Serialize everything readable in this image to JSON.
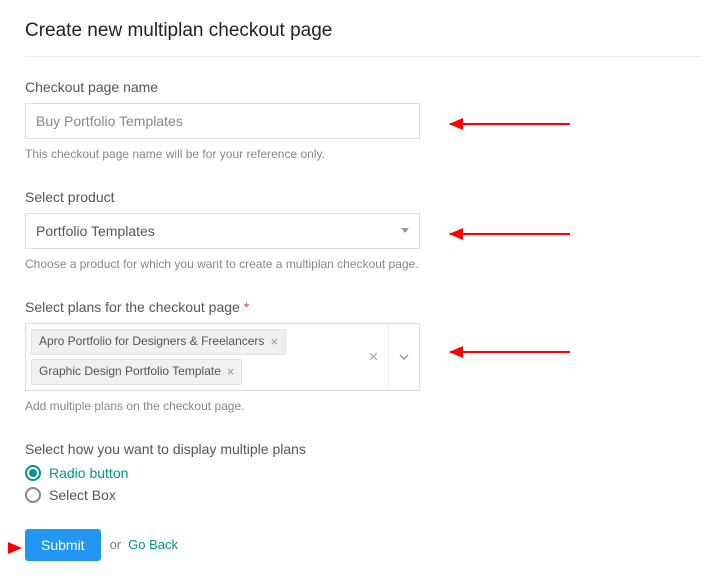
{
  "page_title": "Create new multiplan checkout page",
  "checkout_name": {
    "label": "Checkout page name",
    "value": "Buy Portfolio Templates",
    "help": "This checkout page name will be for your reference only."
  },
  "product": {
    "label": "Select product",
    "value": "Portfolio Templates",
    "help": "Choose a product for which you want to create a multiplan checkout page."
  },
  "plans": {
    "label": "Select plans for the checkout page",
    "required": "*",
    "chips": [
      "Apro Portfolio for Designers & Freelancers",
      "Graphic Design Portfolio Template"
    ],
    "help": "Add multiple plans on the checkout page."
  },
  "display": {
    "label": "Select how you want to display multiple plans",
    "options": [
      "Radio button",
      "Select Box"
    ],
    "selected": 0
  },
  "actions": {
    "submit": "Submit",
    "or": "or",
    "goback": "Go Back"
  }
}
